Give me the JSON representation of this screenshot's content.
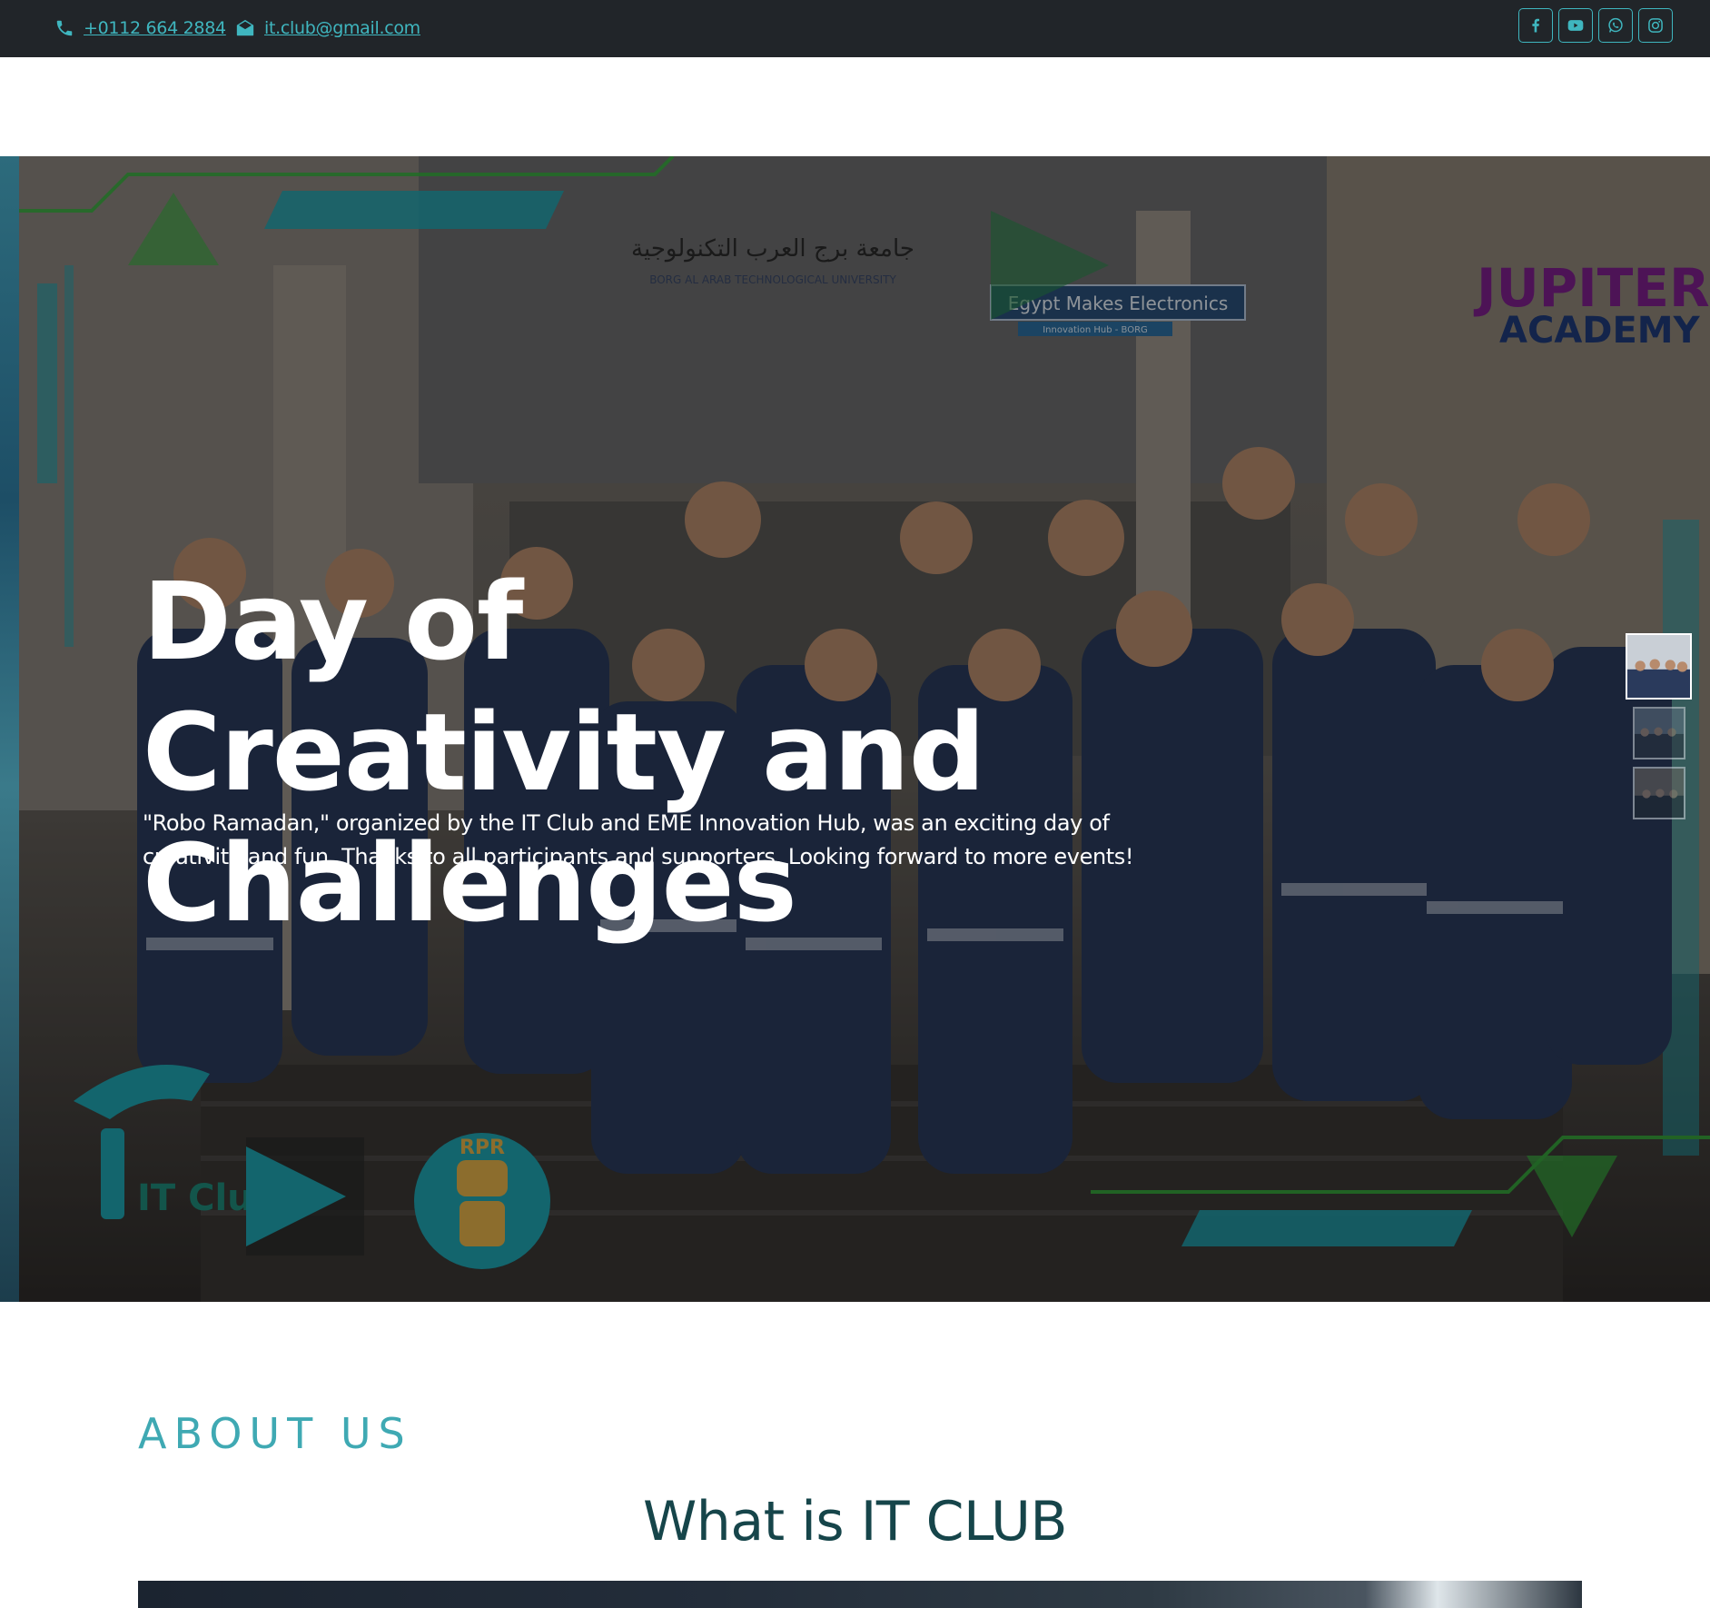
{
  "topbar": {
    "phone": "+0112 664 2884",
    "email": "it.club@gmail.com",
    "phone_icon": "phone-icon",
    "email_icon": "envelope-open-icon",
    "social": [
      {
        "name": "facebook-icon",
        "label": "Facebook"
      },
      {
        "name": "youtube-icon",
        "label": "YouTube"
      },
      {
        "name": "whatsapp-icon",
        "label": "WhatsApp"
      },
      {
        "name": "instagram-icon",
        "label": "Instagram"
      }
    ]
  },
  "hero": {
    "title": "Day of Creativity and Challenges",
    "description": "\"Robo Ramadan,\" organized by the IT Club and EME Innovation Hub, was an exciting day of creativity and fun. Thanks to all participants and supporters. Looking forward to more events!",
    "photo_text": {
      "university_arabic": "جامعة برج العرب التكنولوجية",
      "university_english": "BORG AL ARAB TECHNOLOGICAL UNIVERSITY",
      "eme": "Egypt Makes Electronics",
      "eme_sub": "Innovation Hub - BORG",
      "jupiter_1": "JUPITER",
      "jupiter_2": "ACADEMY",
      "rpr": "RPR",
      "it_logo": "IT Club"
    },
    "thumbnails": [
      "slide-1",
      "slide-2",
      "slide-3"
    ],
    "active_thumbnail": 0
  },
  "about": {
    "label": "ABOUT US",
    "title": "What is IT CLUB"
  },
  "colors": {
    "topbar_bg": "#212529",
    "accent": "#3fb6bf",
    "about_label": "#3fa9b3",
    "about_title": "#16454a"
  }
}
